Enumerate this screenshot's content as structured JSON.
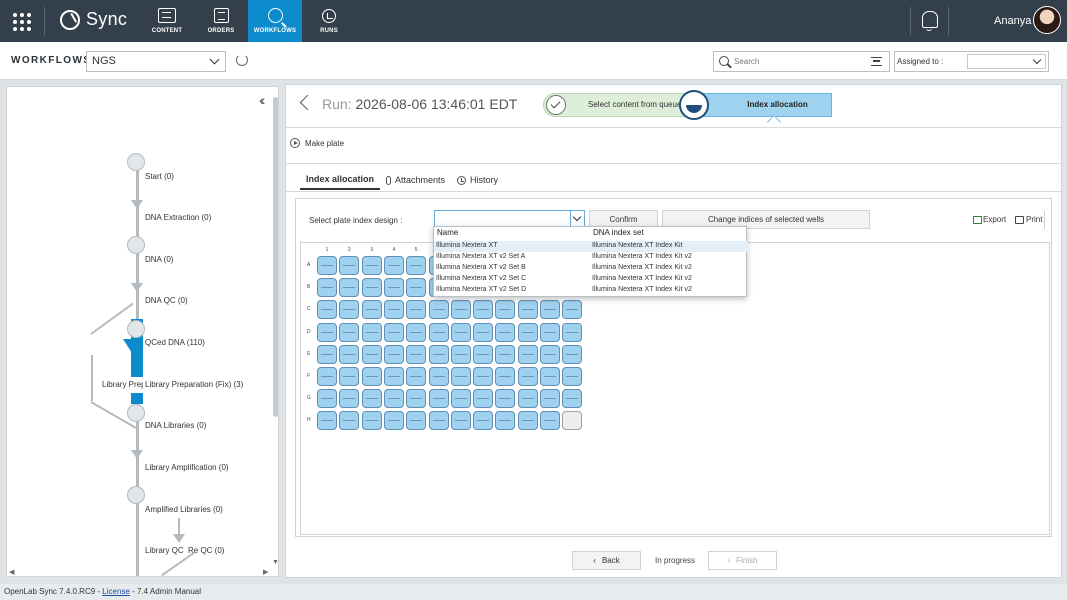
{
  "app": {
    "name": "Sync"
  },
  "nav": [
    {
      "label": "CONTENT",
      "icon": "content-icon",
      "active": false
    },
    {
      "label": "ORDERS",
      "icon": "orders-icon",
      "active": false
    },
    {
      "label": "WORKFLOWS",
      "icon": "workflows-icon",
      "active": true
    },
    {
      "label": "RUNS",
      "icon": "runs-icon",
      "active": false
    }
  ],
  "user": {
    "name": "Ananya"
  },
  "workflow_bar": {
    "label": "WORKFLOWS",
    "selected": "NGS",
    "search_placeholder": "Search",
    "assigned_label": "Assigned to :",
    "assigned_value": ""
  },
  "flow": {
    "steps": [
      "Start (0)",
      "DNA Extraction (0)",
      "DNA (0)",
      "DNA QC (0)",
      "QCed DNA (110)",
      "Library Preparation (Fix) (3)",
      "DNA Libraries (0)",
      "Library Amplification (0)",
      "Amplified Libraries (0)",
      "Library QC (",
      "Re QC (0)"
    ],
    "overlap_label": "Library Prep"
  },
  "run": {
    "prefix": "Run:",
    "title": "2026-08-06 13:46:01 EDT",
    "step_done": "Select content from queue",
    "step_current": "Index allocation",
    "make_plate": "Make plate"
  },
  "tabs": [
    {
      "label": "Index allocation",
      "active": true
    },
    {
      "label": "Attachments",
      "active": false
    },
    {
      "label": "History",
      "active": false
    }
  ],
  "allocation": {
    "select_label": "Select plate index design :",
    "select_value": "",
    "confirm": "Confirm",
    "change": "Change indices of selected wells",
    "export": "Export",
    "print": "Print"
  },
  "plate": {
    "columns": [
      "1",
      "2",
      "3",
      "4",
      "5",
      "6",
      "7",
      "8",
      "9",
      "10",
      "11",
      "12"
    ],
    "rows": [
      "A",
      "B",
      "C",
      "D",
      "E",
      "F",
      "G",
      "H"
    ],
    "empty_wells": [
      "H12"
    ],
    "hidden_by_dropdown": true
  },
  "dropdown": {
    "headers": {
      "name": "Name",
      "set": "DNA index set"
    },
    "options": [
      {
        "name": "Illumina Nextera XT",
        "set": "Illumina Nextera XT Index Kit"
      },
      {
        "name": "Illumina Nextera XT v2 Set A",
        "set": "Illumina Nextera XT Index Kit v2"
      },
      {
        "name": "Illumina Nextera XT v2 Set B",
        "set": "Illumina Nextera XT Index Kit v2"
      },
      {
        "name": "Illumina Nextera XT v2 Set C",
        "set": "Illumina Nextera XT Index Kit v2"
      },
      {
        "name": "Illumina Nextera XT v2 Set D",
        "set": "Illumina Nextera XT Index Kit v2"
      }
    ]
  },
  "footer": {
    "back": "Back",
    "status": "In progress",
    "finish": "Finish"
  },
  "statusbar": {
    "version": "OpenLab Sync 7.4.0.RC9 -",
    "license": "License",
    "manual": "- 7.4 Admin Manual"
  },
  "colors": {
    "topbar": "#33404b",
    "accent": "#0d8ccd",
    "well": "#9fd2ee",
    "done_step": "#ddeed9"
  }
}
